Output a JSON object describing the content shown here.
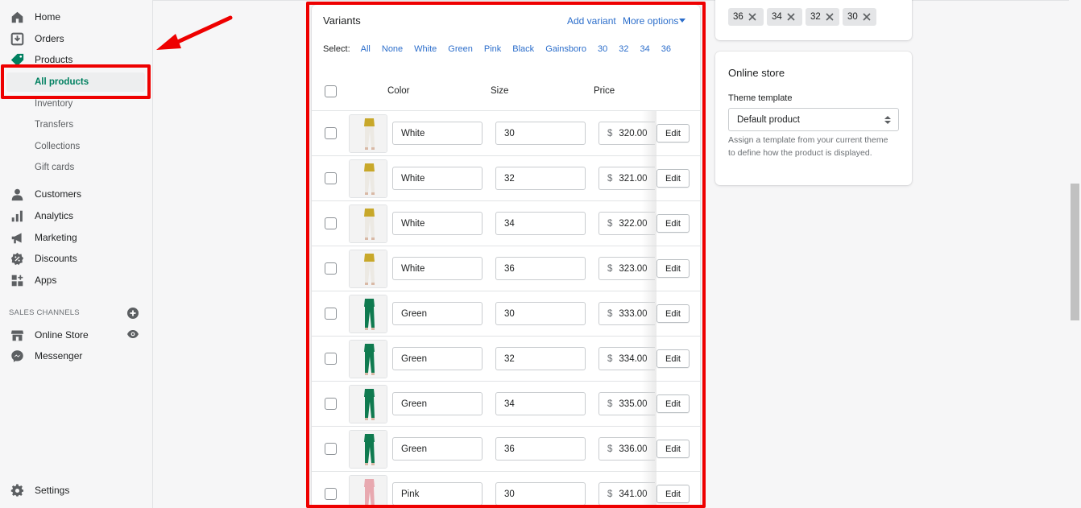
{
  "sidebar": {
    "home": "Home",
    "orders": "Orders",
    "products": "Products",
    "all_products": "All products",
    "inventory": "Inventory",
    "transfers": "Transfers",
    "collections": "Collections",
    "gift_cards": "Gift cards",
    "customers": "Customers",
    "analytics": "Analytics",
    "marketing": "Marketing",
    "discounts": "Discounts",
    "apps": "Apps",
    "sales_channels": "SALES CHANNELS",
    "online_store": "Online Store",
    "messenger": "Messenger",
    "settings": "Settings"
  },
  "variants": {
    "title": "Variants",
    "add_variant": "Add variant",
    "more_options": "More options",
    "select_label": "Select:",
    "select_options": [
      "All",
      "None",
      "White",
      "Green",
      "Pink",
      "Black",
      "Gainsboro",
      "30",
      "32",
      "34",
      "36"
    ],
    "columns": {
      "color": "Color",
      "size": "Size",
      "price": "Price"
    },
    "currency": "$",
    "edit_label": "Edit",
    "rows": [
      {
        "color": "White",
        "size": "30",
        "price": "320.00",
        "swatch": "#c8a82a"
      },
      {
        "color": "White",
        "size": "32",
        "price": "321.00",
        "swatch": "#c8a82a"
      },
      {
        "color": "White",
        "size": "34",
        "price": "322.00",
        "swatch": "#c8a82a"
      },
      {
        "color": "White",
        "size": "36",
        "price": "323.00",
        "swatch": "#c8a82a"
      },
      {
        "color": "Green",
        "size": "30",
        "price": "333.00",
        "swatch": "#0f7a4f"
      },
      {
        "color": "Green",
        "size": "32",
        "price": "334.00",
        "swatch": "#0f7a4f"
      },
      {
        "color": "Green",
        "size": "34",
        "price": "335.00",
        "swatch": "#0f7a4f"
      },
      {
        "color": "Green",
        "size": "36",
        "price": "336.00",
        "swatch": "#0f7a4f"
      },
      {
        "color": "Pink",
        "size": "30",
        "price": "341.00",
        "swatch": "#e8a9b0"
      }
    ]
  },
  "tags": [
    "36",
    "34",
    "32",
    "30"
  ],
  "online_store": {
    "title": "Online store",
    "theme_label": "Theme template",
    "theme_value": "Default product",
    "help": "Assign a template from your current theme to define how the product is displayed."
  },
  "colors": {
    "accent": "#008060",
    "link": "#2c6ecb",
    "annotation": "#ee0000"
  }
}
